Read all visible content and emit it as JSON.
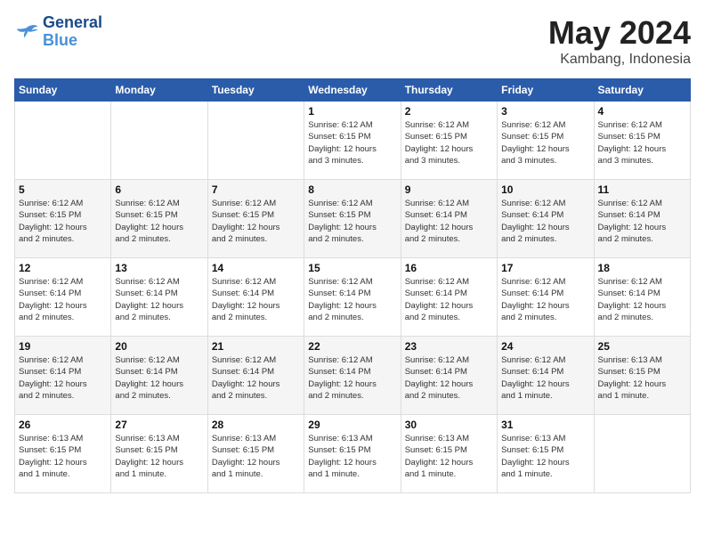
{
  "header": {
    "logo_line1": "General",
    "logo_line2": "Blue",
    "month": "May 2024",
    "location": "Kambang, Indonesia"
  },
  "weekdays": [
    "Sunday",
    "Monday",
    "Tuesday",
    "Wednesday",
    "Thursday",
    "Friday",
    "Saturday"
  ],
  "weeks": [
    [
      {
        "day": "",
        "info": ""
      },
      {
        "day": "",
        "info": ""
      },
      {
        "day": "",
        "info": ""
      },
      {
        "day": "1",
        "info": "Sunrise: 6:12 AM\nSunset: 6:15 PM\nDaylight: 12 hours\nand 3 minutes."
      },
      {
        "day": "2",
        "info": "Sunrise: 6:12 AM\nSunset: 6:15 PM\nDaylight: 12 hours\nand 3 minutes."
      },
      {
        "day": "3",
        "info": "Sunrise: 6:12 AM\nSunset: 6:15 PM\nDaylight: 12 hours\nand 3 minutes."
      },
      {
        "day": "4",
        "info": "Sunrise: 6:12 AM\nSunset: 6:15 PM\nDaylight: 12 hours\nand 3 minutes."
      }
    ],
    [
      {
        "day": "5",
        "info": "Sunrise: 6:12 AM\nSunset: 6:15 PM\nDaylight: 12 hours\nand 2 minutes."
      },
      {
        "day": "6",
        "info": "Sunrise: 6:12 AM\nSunset: 6:15 PM\nDaylight: 12 hours\nand 2 minutes."
      },
      {
        "day": "7",
        "info": "Sunrise: 6:12 AM\nSunset: 6:15 PM\nDaylight: 12 hours\nand 2 minutes."
      },
      {
        "day": "8",
        "info": "Sunrise: 6:12 AM\nSunset: 6:15 PM\nDaylight: 12 hours\nand 2 minutes."
      },
      {
        "day": "9",
        "info": "Sunrise: 6:12 AM\nSunset: 6:14 PM\nDaylight: 12 hours\nand 2 minutes."
      },
      {
        "day": "10",
        "info": "Sunrise: 6:12 AM\nSunset: 6:14 PM\nDaylight: 12 hours\nand 2 minutes."
      },
      {
        "day": "11",
        "info": "Sunrise: 6:12 AM\nSunset: 6:14 PM\nDaylight: 12 hours\nand 2 minutes."
      }
    ],
    [
      {
        "day": "12",
        "info": "Sunrise: 6:12 AM\nSunset: 6:14 PM\nDaylight: 12 hours\nand 2 minutes."
      },
      {
        "day": "13",
        "info": "Sunrise: 6:12 AM\nSunset: 6:14 PM\nDaylight: 12 hours\nand 2 minutes."
      },
      {
        "day": "14",
        "info": "Sunrise: 6:12 AM\nSunset: 6:14 PM\nDaylight: 12 hours\nand 2 minutes."
      },
      {
        "day": "15",
        "info": "Sunrise: 6:12 AM\nSunset: 6:14 PM\nDaylight: 12 hours\nand 2 minutes."
      },
      {
        "day": "16",
        "info": "Sunrise: 6:12 AM\nSunset: 6:14 PM\nDaylight: 12 hours\nand 2 minutes."
      },
      {
        "day": "17",
        "info": "Sunrise: 6:12 AM\nSunset: 6:14 PM\nDaylight: 12 hours\nand 2 minutes."
      },
      {
        "day": "18",
        "info": "Sunrise: 6:12 AM\nSunset: 6:14 PM\nDaylight: 12 hours\nand 2 minutes."
      }
    ],
    [
      {
        "day": "19",
        "info": "Sunrise: 6:12 AM\nSunset: 6:14 PM\nDaylight: 12 hours\nand 2 minutes."
      },
      {
        "day": "20",
        "info": "Sunrise: 6:12 AM\nSunset: 6:14 PM\nDaylight: 12 hours\nand 2 minutes."
      },
      {
        "day": "21",
        "info": "Sunrise: 6:12 AM\nSunset: 6:14 PM\nDaylight: 12 hours\nand 2 minutes."
      },
      {
        "day": "22",
        "info": "Sunrise: 6:12 AM\nSunset: 6:14 PM\nDaylight: 12 hours\nand 2 minutes."
      },
      {
        "day": "23",
        "info": "Sunrise: 6:12 AM\nSunset: 6:14 PM\nDaylight: 12 hours\nand 2 minutes."
      },
      {
        "day": "24",
        "info": "Sunrise: 6:12 AM\nSunset: 6:14 PM\nDaylight: 12 hours\nand 1 minute."
      },
      {
        "day": "25",
        "info": "Sunrise: 6:13 AM\nSunset: 6:15 PM\nDaylight: 12 hours\nand 1 minute."
      }
    ],
    [
      {
        "day": "26",
        "info": "Sunrise: 6:13 AM\nSunset: 6:15 PM\nDaylight: 12 hours\nand 1 minute."
      },
      {
        "day": "27",
        "info": "Sunrise: 6:13 AM\nSunset: 6:15 PM\nDaylight: 12 hours\nand 1 minute."
      },
      {
        "day": "28",
        "info": "Sunrise: 6:13 AM\nSunset: 6:15 PM\nDaylight: 12 hours\nand 1 minute."
      },
      {
        "day": "29",
        "info": "Sunrise: 6:13 AM\nSunset: 6:15 PM\nDaylight: 12 hours\nand 1 minute."
      },
      {
        "day": "30",
        "info": "Sunrise: 6:13 AM\nSunset: 6:15 PM\nDaylight: 12 hours\nand 1 minute."
      },
      {
        "day": "31",
        "info": "Sunrise: 6:13 AM\nSunset: 6:15 PM\nDaylight: 12 hours\nand 1 minute."
      },
      {
        "day": "",
        "info": ""
      }
    ]
  ]
}
